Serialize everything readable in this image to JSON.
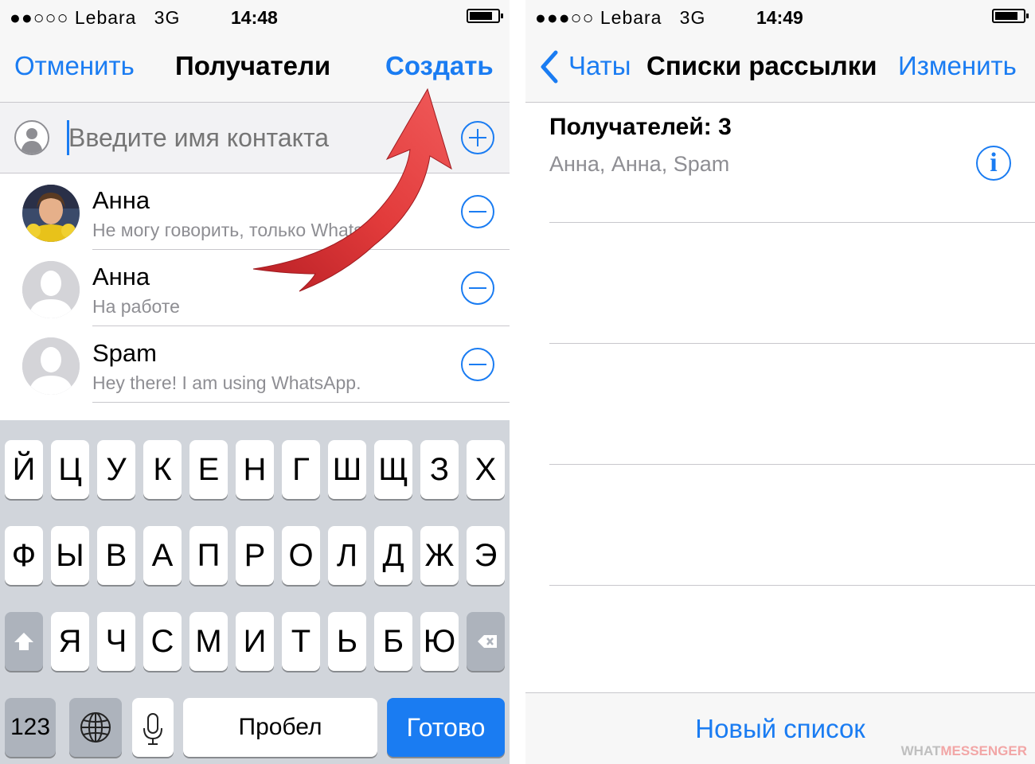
{
  "left": {
    "status": {
      "signal": "●●○○○",
      "carrier": "Lebara",
      "network": "3G",
      "time": "14:48"
    },
    "nav": {
      "cancel": "Отменить",
      "title": "Получатели",
      "create": "Создать"
    },
    "search": {
      "placeholder": "Введите имя контакта"
    },
    "contacts": [
      {
        "name": "Анна",
        "subtitle": "Не могу говорить, только Whats..."
      },
      {
        "name": "Анна",
        "subtitle": "На работе"
      },
      {
        "name": "Spam",
        "subtitle": "Hey there! I am using WhatsApp."
      }
    ],
    "keyboard": {
      "row1": [
        "Й",
        "Ц",
        "У",
        "К",
        "Е",
        "Н",
        "Г",
        "Ш",
        "Щ",
        "З",
        "Х"
      ],
      "row2": [
        "Ф",
        "Ы",
        "В",
        "А",
        "П",
        "Р",
        "О",
        "Л",
        "Д",
        "Ж",
        "Э"
      ],
      "row3": [
        "Я",
        "Ч",
        "С",
        "М",
        "И",
        "Т",
        "Ь",
        "Б",
        "Ю"
      ],
      "numbers": "123",
      "space": "Пробел",
      "done": "Готово"
    }
  },
  "right": {
    "status": {
      "signal": "●●●○○",
      "carrier": "Lebara",
      "network": "3G",
      "time": "14:49"
    },
    "nav": {
      "back": "Чаты",
      "title": "Списки рассылки",
      "edit": "Изменить"
    },
    "list": {
      "title": "Получателей: 3",
      "members": "Анна, Анна, Spam"
    },
    "new_list": "Новый список",
    "watermark": {
      "part1": "WHAT",
      "part2": "MESSENGER"
    }
  },
  "colors": {
    "accent": "#1a7cf2",
    "arrow": "#e23b3b",
    "keyboard_bg": "#d1d5db"
  }
}
